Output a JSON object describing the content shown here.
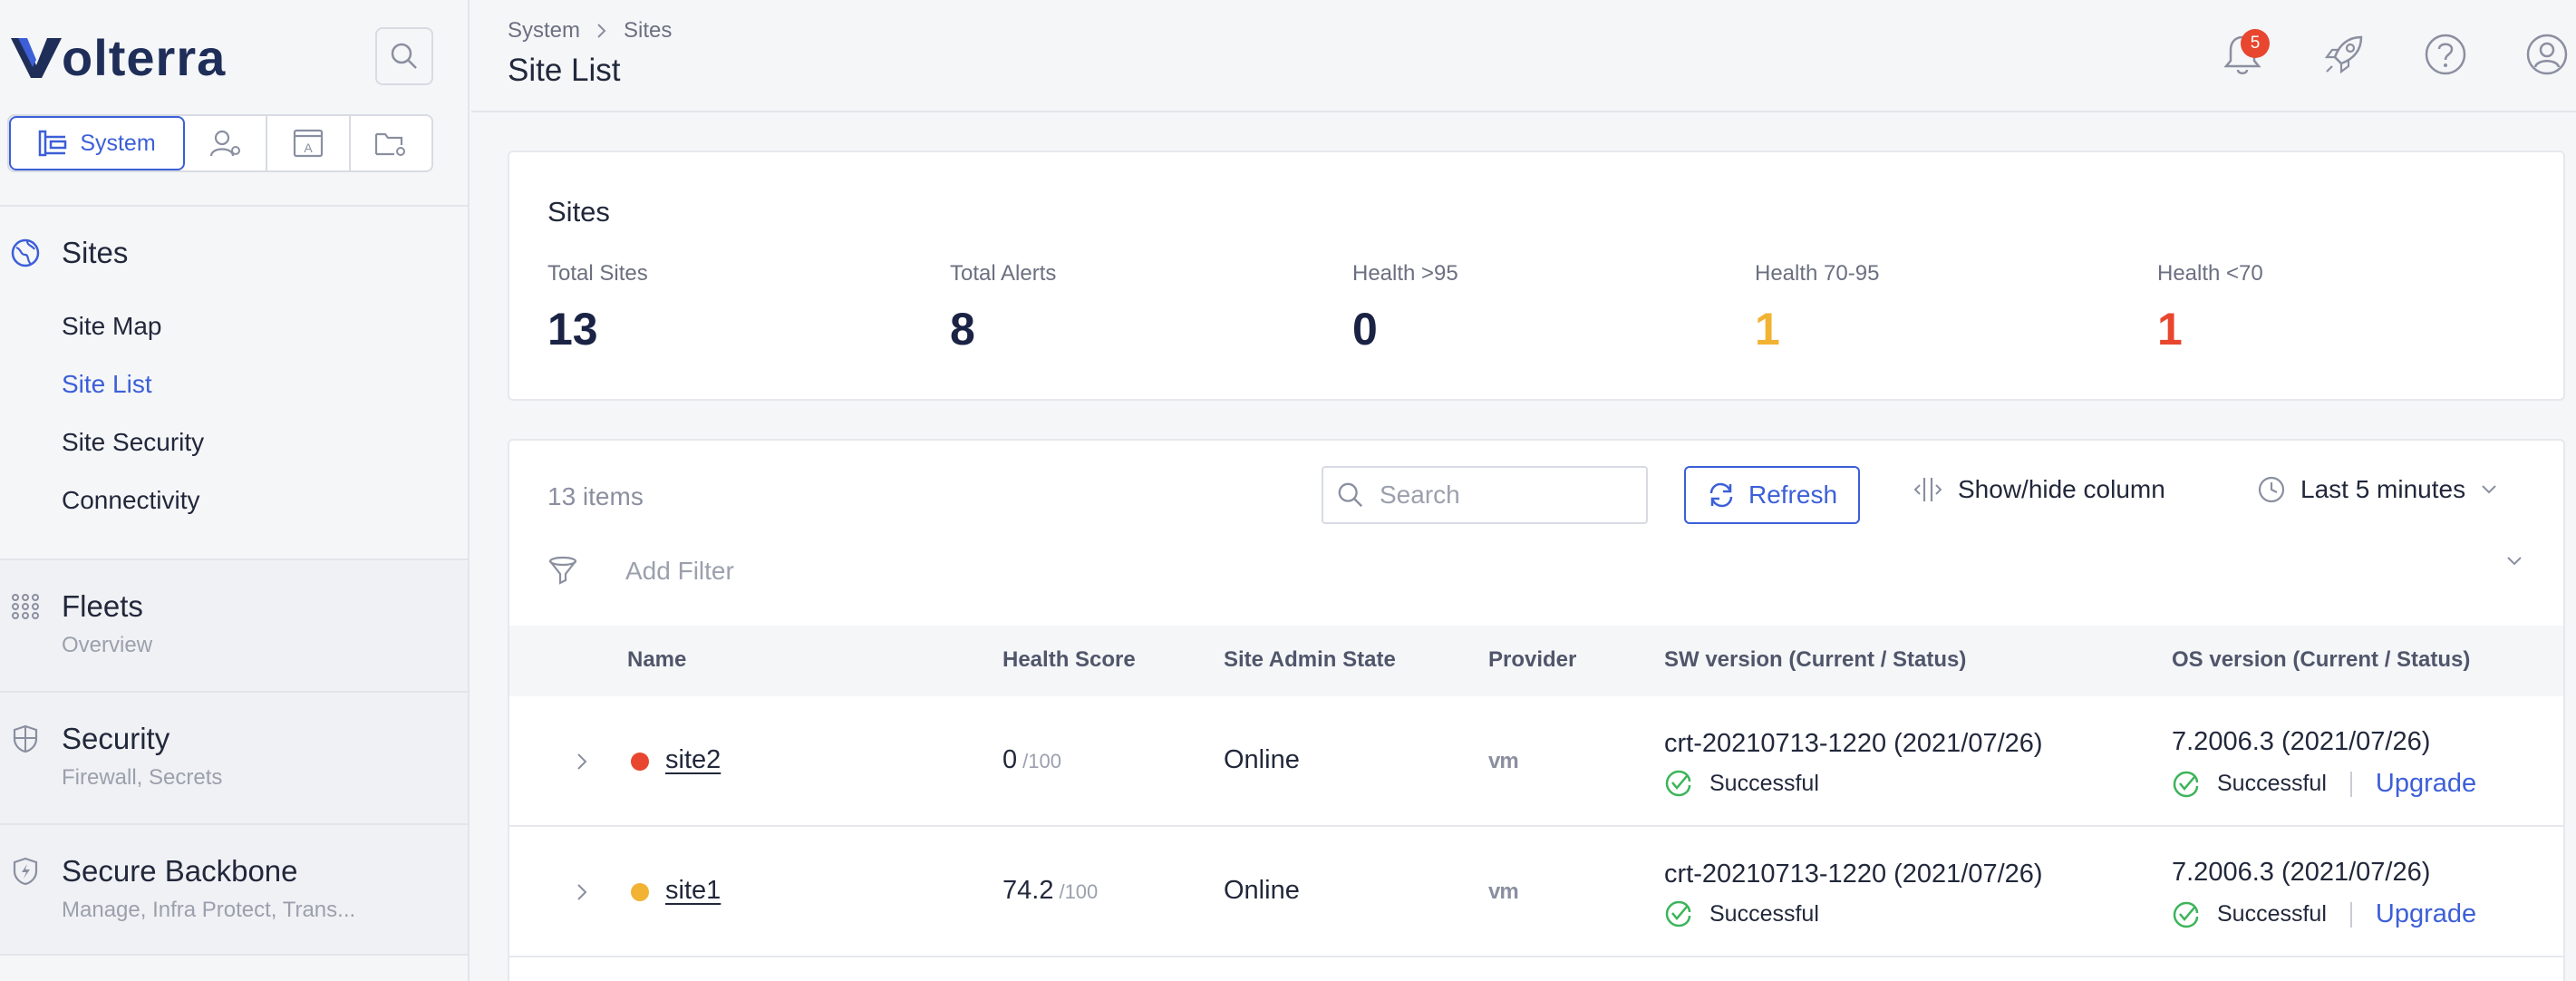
{
  "brand": {
    "name": "olterra",
    "accent": "#3c5fd8"
  },
  "sidebar": {
    "workspace": {
      "active_label": "System"
    },
    "sites": {
      "label": "Sites",
      "items": [
        {
          "label": "Site Map"
        },
        {
          "label": "Site List"
        },
        {
          "label": "Site Security"
        },
        {
          "label": "Connectivity"
        }
      ]
    },
    "sections": [
      {
        "label": "Fleets",
        "sub": "Overview"
      },
      {
        "label": "Security",
        "sub": "Firewall, Secrets"
      },
      {
        "label": "Secure Backbone",
        "sub": "Manage, Infra Protect, Trans..."
      }
    ]
  },
  "header": {
    "breadcrumb": [
      "System",
      "Sites"
    ],
    "title": "Site List",
    "notifications_count": "5"
  },
  "summary": {
    "title": "Sites",
    "stats": [
      {
        "label": "Total Sites",
        "value": "13",
        "color": "#1a2344"
      },
      {
        "label": "Total Alerts",
        "value": "8",
        "color": "#1a2344"
      },
      {
        "label": "Health >95",
        "value": "0",
        "color": "#1a2344"
      },
      {
        "label": "Health 70-95",
        "value": "1",
        "color": "#f2b233"
      },
      {
        "label": "Health <70",
        "value": "1",
        "color": "#e8462f"
      }
    ]
  },
  "toolbar": {
    "items_count": "13 items",
    "search_placeholder": "Search",
    "refresh_label": "Refresh",
    "showhide_label": "Show/hide column",
    "time_range": "Last 5 minutes",
    "filter_placeholder": "Add Filter"
  },
  "table": {
    "columns": [
      "Name",
      "Health Score",
      "Site Admin State",
      "Provider",
      "SW version (Current / Status)",
      "OS version (Current / Status)"
    ],
    "rows": [
      {
        "name": "site2",
        "status_color": "#e8462f",
        "score": "0",
        "score_max": "/100",
        "state": "Online",
        "provider": "vm",
        "sw_version": "crt-20210713-1220 (2021/07/26)",
        "sw_status": "Successful",
        "os_version": "7.2006.3 (2021/07/26)",
        "os_status": "Successful",
        "os_action": "Upgrade"
      },
      {
        "name": "site1",
        "status_color": "#f2b233",
        "score": "74.2",
        "score_max": "/100",
        "state": "Online",
        "provider": "vm",
        "sw_version": "crt-20210713-1220 (2021/07/26)",
        "sw_status": "Successful",
        "os_version": "7.2006.3 (2021/07/26)",
        "os_status": "Successful",
        "os_action": "Upgrade"
      }
    ]
  }
}
